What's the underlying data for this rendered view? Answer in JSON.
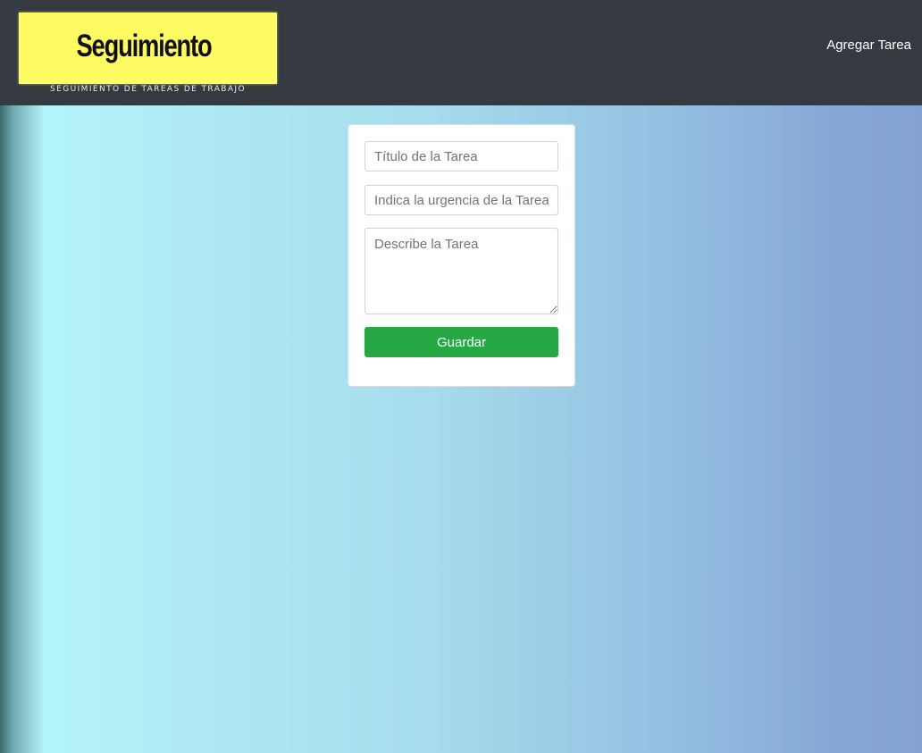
{
  "header": {
    "logo": {
      "title": "Seguimiento",
      "subtitle": "SEGUIMIENTO DE TAREAS DE TRABAJO",
      "background_color": "#fffb63"
    },
    "nav_link_label": "Agregar Tarea",
    "background_color": "#343a40"
  },
  "form": {
    "title_placeholder": "Título de la Tarea",
    "title_value": "",
    "urgency_placeholder": "Indica la urgencia de la Tarea",
    "urgency_value": "",
    "description_placeholder": "Describe la Tarea",
    "description_value": "",
    "save_label": "Guardar",
    "save_color": "#28a745"
  }
}
